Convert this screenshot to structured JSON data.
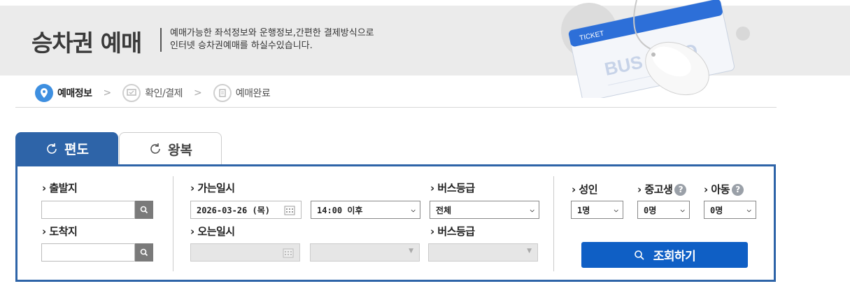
{
  "header": {
    "title": "승차권 예매",
    "desc_line1": "예매가능한 좌석정보와 운행정보,간편한 결제방식으로",
    "desc_line2": "인터넷 승차권예매를 하실수있습니다.",
    "ticket_text": "TICKET",
    "ticket_brand": "BUS TAGO"
  },
  "steps": [
    {
      "label": "예매정보",
      "icon": "location-pin-icon",
      "active": true
    },
    {
      "label": "확인/결제",
      "icon": "check-monitor-icon",
      "active": false
    },
    {
      "label": "예매완료",
      "icon": "document-icon",
      "active": false
    }
  ],
  "tabs": {
    "one_way": "편도",
    "round_trip": "왕복"
  },
  "form": {
    "departure_label": "출발지",
    "arrival_label": "도착지",
    "departure_date_label": "가는일시",
    "departure_date_value": "2026-03-26 (목)",
    "departure_time_value": "14:00 이후",
    "bus_class_label": "버스등급",
    "bus_class_value": "전체",
    "return_date_label": "오는일시",
    "return_bus_class_label": "버스등급",
    "adult_label": "성인",
    "adult_value": "1명",
    "student_label": "중고생",
    "student_value": "0명",
    "child_label": "아동",
    "child_value": "0명",
    "help_mark": "?",
    "search_button": "조회하기"
  },
  "colors": {
    "primary": "#2e64a8",
    "button": "#0f5fc5",
    "banner": "#ebebeb"
  }
}
